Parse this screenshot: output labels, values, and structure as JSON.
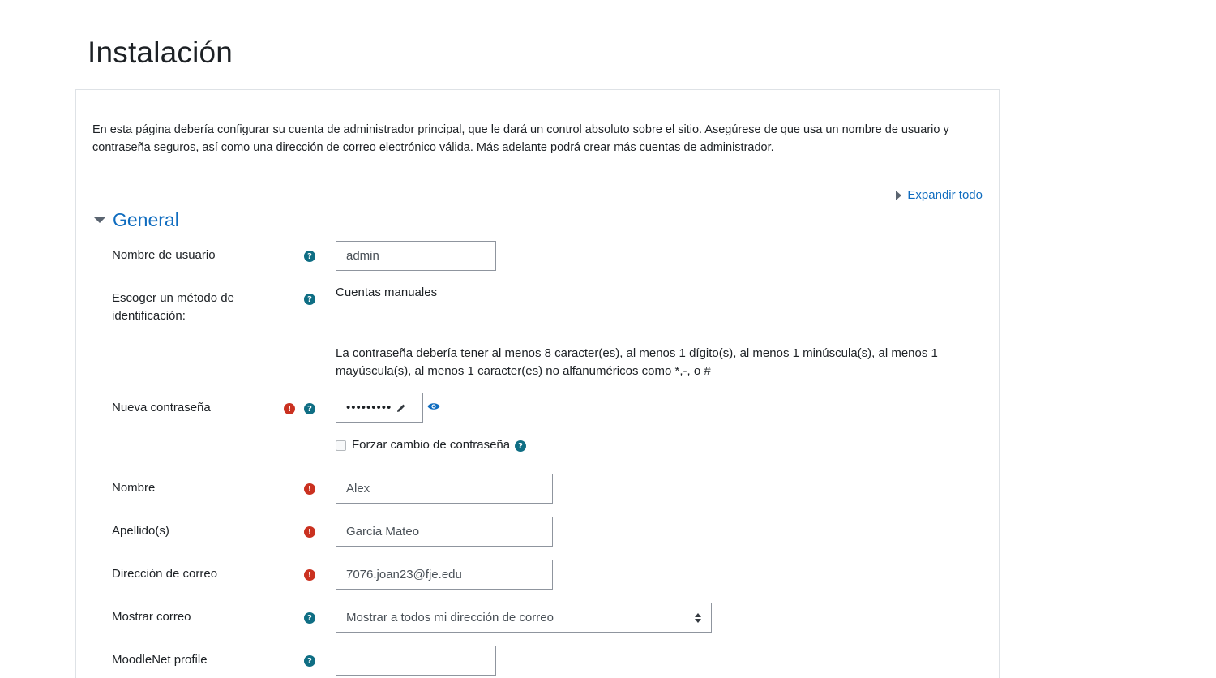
{
  "page": {
    "title": "Instalación"
  },
  "intro": "En esta página debería configurar su cuenta de administrador principal, que le dará un control absoluto sobre el sitio. Asegúrese de que usa un nombre de usuario y contraseña seguros, así como una dirección de correo electrónico válida. Más adelante podrá crear más cuentas de administrador.",
  "expand_all": "Expandir todo",
  "section": {
    "title": "General"
  },
  "fields": {
    "username": {
      "label": "Nombre de usuario",
      "value": "admin"
    },
    "auth": {
      "label": "Escoger un método de identificación:",
      "value": "Cuentas manuales"
    },
    "password_rules": "La contraseña debería tener al menos 8 caracter(es), al menos 1 dígito(s), al menos 1 minúscula(s), al menos 1 mayúscula(s), al menos 1 caracter(es) no alfanuméricos como *,-, o #",
    "new_password": {
      "label": "Nueva contraseña",
      "value": "•••••••••"
    },
    "force_change": {
      "label": "Forzar cambio de contraseña",
      "checked": false
    },
    "firstname": {
      "label": "Nombre",
      "value": "Alex"
    },
    "lastname": {
      "label": "Apellido(s)",
      "value": "Garcia Mateo"
    },
    "email": {
      "label": "Dirección de correo",
      "value": "7076.joan23@fje.edu"
    },
    "show_email": {
      "label": "Mostrar correo",
      "value": "Mostrar a todos mi dirección de correo"
    },
    "moodlenet": {
      "label": "MoodleNet profile",
      "value": ""
    }
  },
  "icons": {
    "help": "question-circle-icon",
    "required": "exclamation-circle-icon",
    "help_glyph": "?",
    "required_glyph": "!"
  },
  "colors": {
    "link": "#0f6cbf",
    "help": "#0f6e84",
    "required": "#ca3120"
  }
}
